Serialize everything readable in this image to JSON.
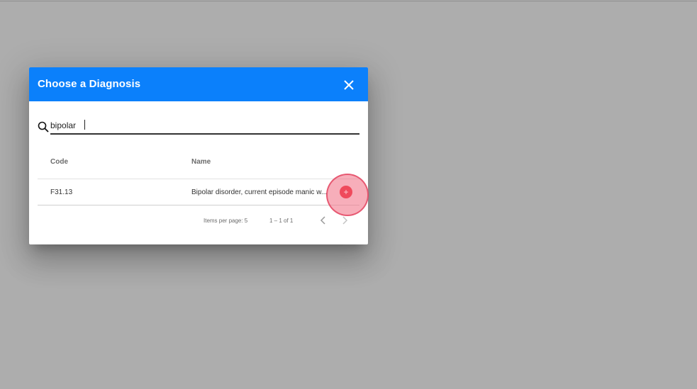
{
  "dialog": {
    "title": "Choose a Diagnosis"
  },
  "search": {
    "value": "bipolar",
    "placeholder": ""
  },
  "table": {
    "columns": [
      "Code",
      "Name"
    ],
    "rows": [
      {
        "code": "F31.13",
        "name": "Bipolar disorder, current episode manic w..."
      }
    ]
  },
  "paginator": {
    "items_per_page_label": "Items per page: 5",
    "range_label": "1 – 1 of 1"
  },
  "icons": {
    "close": "close-icon",
    "search": "search-icon",
    "prev": "chevron-left-icon",
    "next": "chevron-right-icon",
    "add": "plus-icon"
  },
  "colors": {
    "header": "#0b80fb",
    "backdrop": "#adadad",
    "add_button": "#ef4a5c"
  }
}
